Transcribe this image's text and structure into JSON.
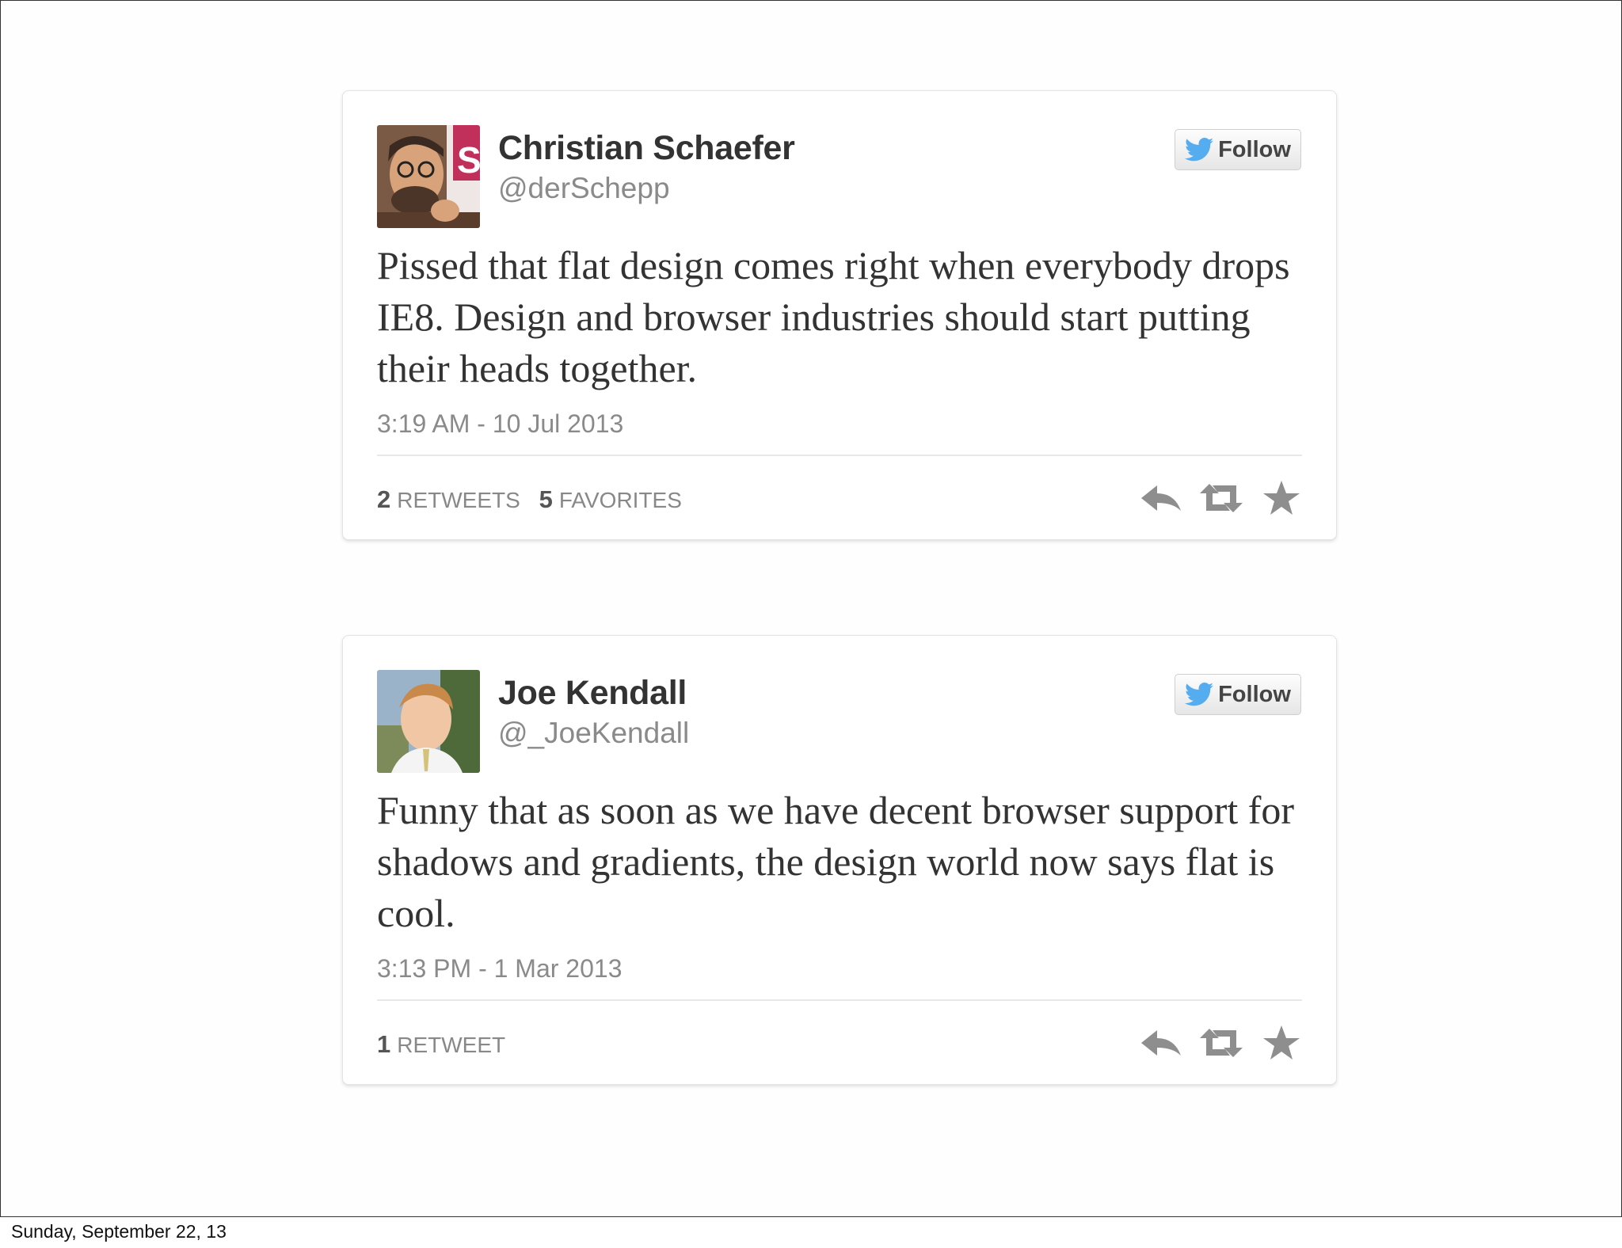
{
  "tweets": [
    {
      "name": "Christian Schaefer",
      "handle": "@derSchepp",
      "follow_label": "Follow",
      "text": "Pissed that flat design comes right when everybody drops IE8. Design and browser industries should start putting their heads together.",
      "timestamp": "3:19 AM - 10 Jul 2013",
      "stats": [
        {
          "count": "2",
          "label": "Retweets"
        },
        {
          "count": "5",
          "label": "Favorites"
        }
      ],
      "icons": [
        "reply-icon",
        "retweet-icon",
        "favorite-icon"
      ]
    },
    {
      "name": "Joe Kendall",
      "handle": "@_JoeKendall",
      "follow_label": "Follow",
      "text": "Funny that as soon as we have decent browser support for shadows and gradients, the design world now says flat is cool.",
      "timestamp": "3:13 PM - 1 Mar 2013",
      "stats": [
        {
          "count": "1",
          "label": "Retweet"
        }
      ],
      "icons": [
        "reply-icon",
        "retweet-icon",
        "favorite-icon"
      ]
    }
  ],
  "footer": "Sunday, September 22, 13",
  "colors": {
    "twitter_blue": "#55acee",
    "action_gray": "#8e8e8e"
  }
}
